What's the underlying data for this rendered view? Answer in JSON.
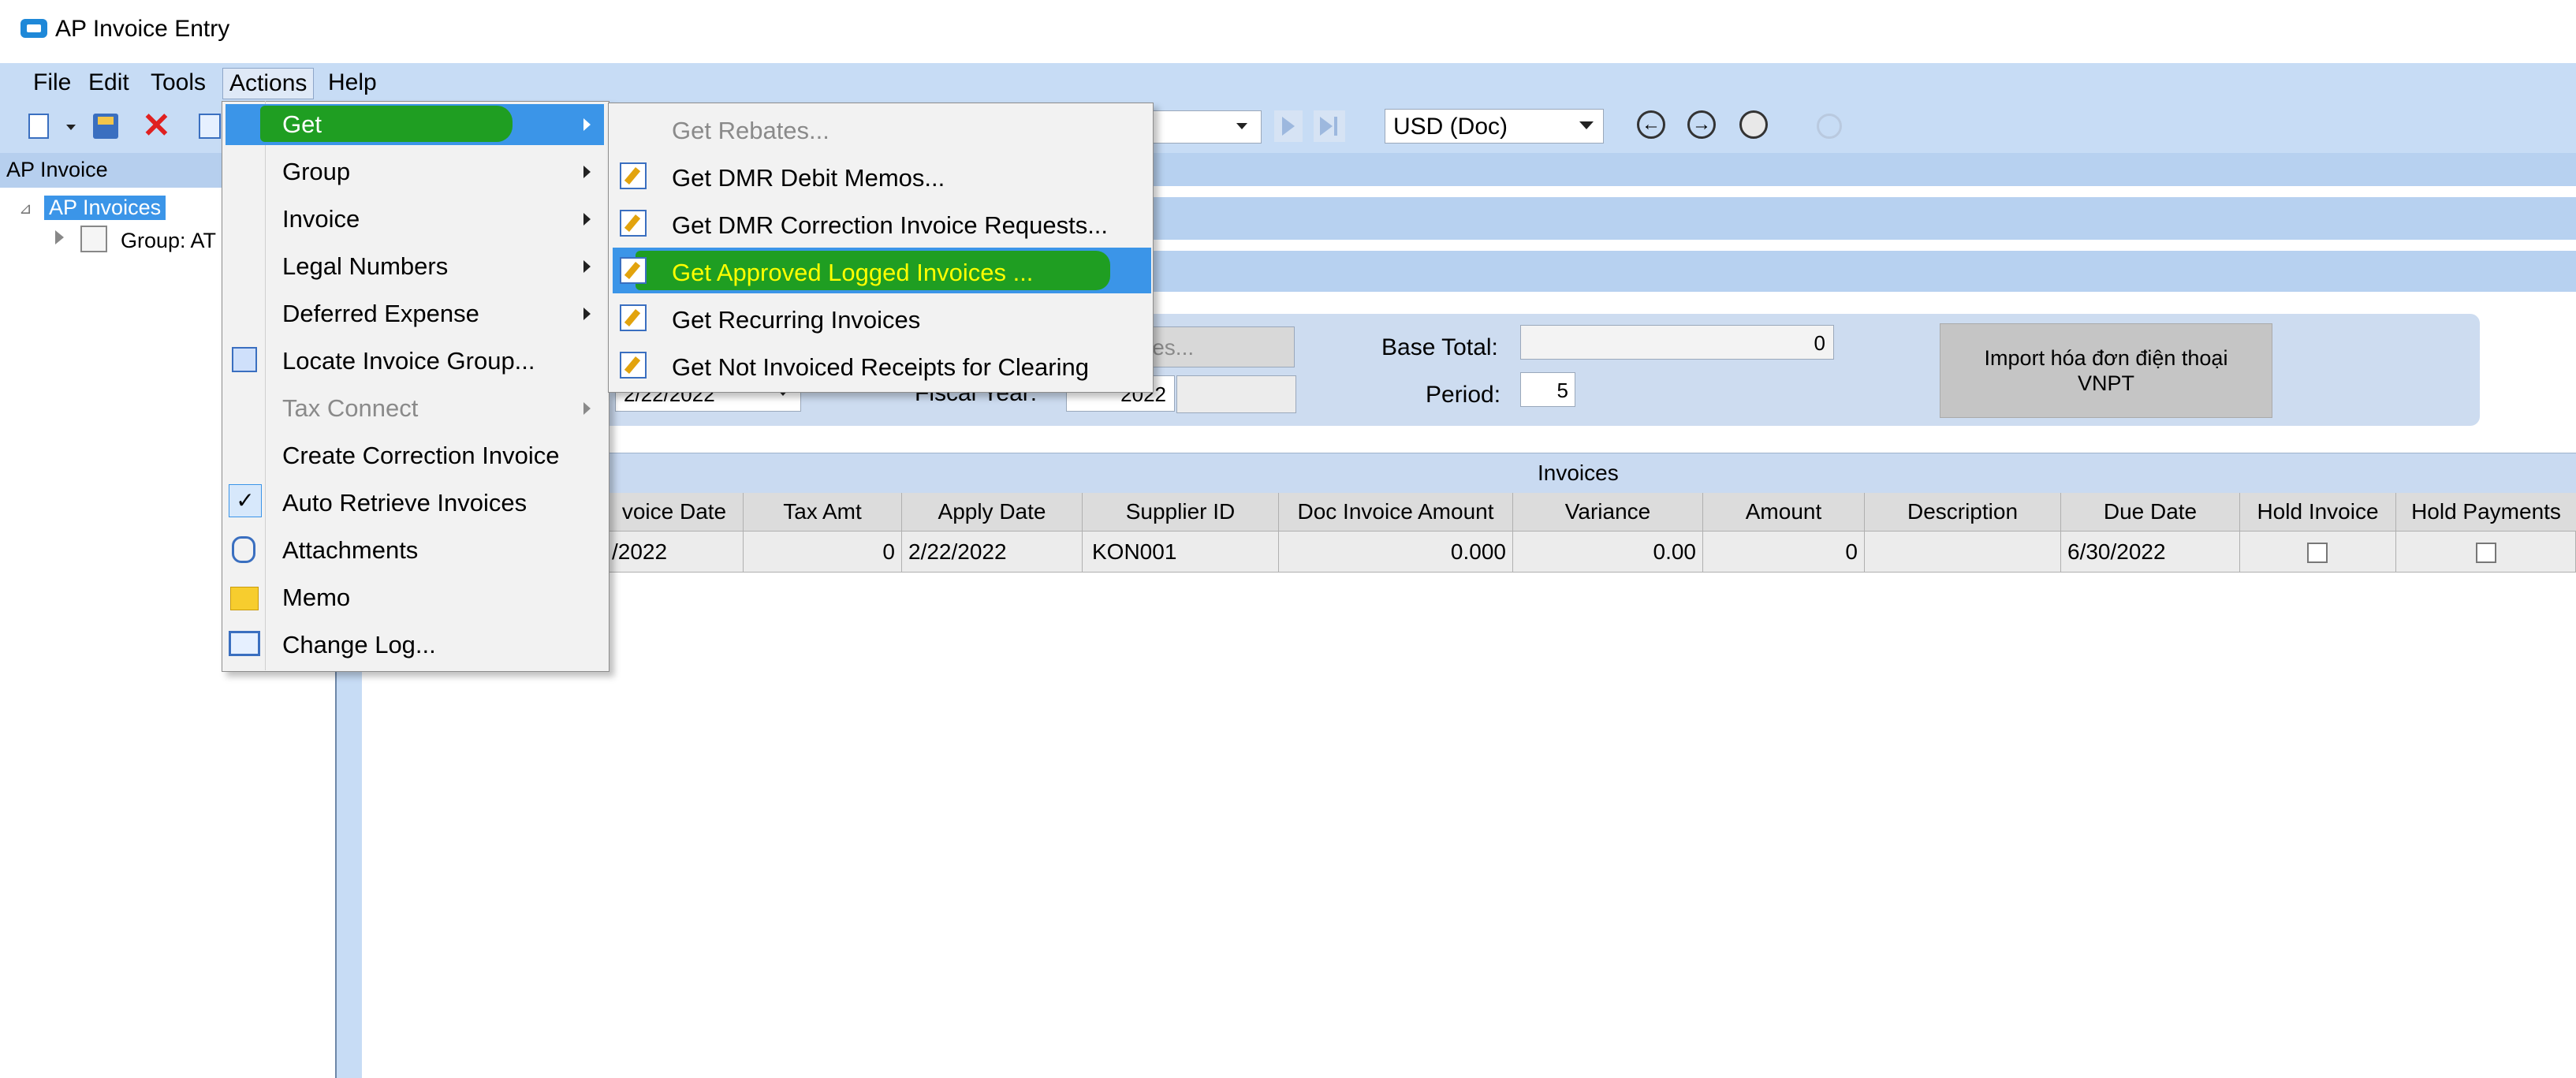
{
  "window": {
    "title": "AP Invoice Entry"
  },
  "menubar": {
    "file": "File",
    "edit": "Edit",
    "tools": "Tools",
    "actions": "Actions",
    "help": "Help"
  },
  "toolbar": {
    "currency_select": "USD (Doc)"
  },
  "tree": {
    "header": "AP Invoice",
    "root": "AP Invoices",
    "group": "Group: AT"
  },
  "form": {
    "invoices_button_partial": "ices...",
    "invoice_date_partial": "2/22/2022",
    "fiscal_year_label": "Fiscal Year:",
    "fiscal_year_value": "2022",
    "base_total_label": "Base Total:",
    "base_total_value": "0",
    "period_label": "Period:",
    "period_value": "5",
    "import_button": "Import hóa đơn điện thoại VNPT"
  },
  "grid": {
    "title": "Invoices",
    "columns": [
      "voice Date",
      "Tax Amt",
      "Apply Date",
      "Supplier ID",
      "Doc Invoice Amount",
      "Variance",
      "Amount",
      "Description",
      "Due Date",
      "Hold Invoice",
      "Hold Payments"
    ],
    "rows": [
      [
        "/2022",
        "0",
        "2/22/2022",
        "KON001",
        "0.000",
        "0.00",
        "0",
        "",
        "6/30/2022",
        false,
        false
      ]
    ]
  },
  "actions_menu": {
    "items": [
      {
        "label": "Get",
        "submenu": true,
        "highlighted": true
      },
      {
        "label": "Group",
        "submenu": true
      },
      {
        "label": "Invoice",
        "submenu": true
      },
      {
        "label": "Legal Numbers",
        "submenu": true
      },
      {
        "label": "Deferred Expense",
        "submenu": true
      },
      {
        "label": "Locate Invoice Group...",
        "icon": "locate-icon"
      },
      {
        "label": "Tax Connect",
        "submenu": true,
        "disabled": true
      },
      {
        "label": "Create Correction Invoice"
      },
      {
        "label": "Auto Retrieve Invoices",
        "icon": "checkmark-icon",
        "checked": true
      },
      {
        "label": "Attachments",
        "icon": "paperclip-icon"
      },
      {
        "label": "Memo",
        "icon": "memo-icon"
      },
      {
        "label": "Change Log...",
        "icon": "book-icon"
      }
    ]
  },
  "get_submenu": {
    "items": [
      {
        "label": "Get Rebates...",
        "disabled": true
      },
      {
        "label": "Get DMR Debit Memos..."
      },
      {
        "label": "Get DMR Correction Invoice Requests..."
      },
      {
        "label": "Get Approved Logged Invoices ...",
        "highlighted": true
      },
      {
        "label": "Get Recurring Invoices"
      },
      {
        "label": "Get Not Invoiced Receipts for Clearing"
      }
    ]
  },
  "colors": {
    "menubar_bg": "#c7dcf5",
    "selection_blue": "#3b95e8",
    "annotation_green": "#1f9e22",
    "highlight_text": "#ffff00"
  }
}
